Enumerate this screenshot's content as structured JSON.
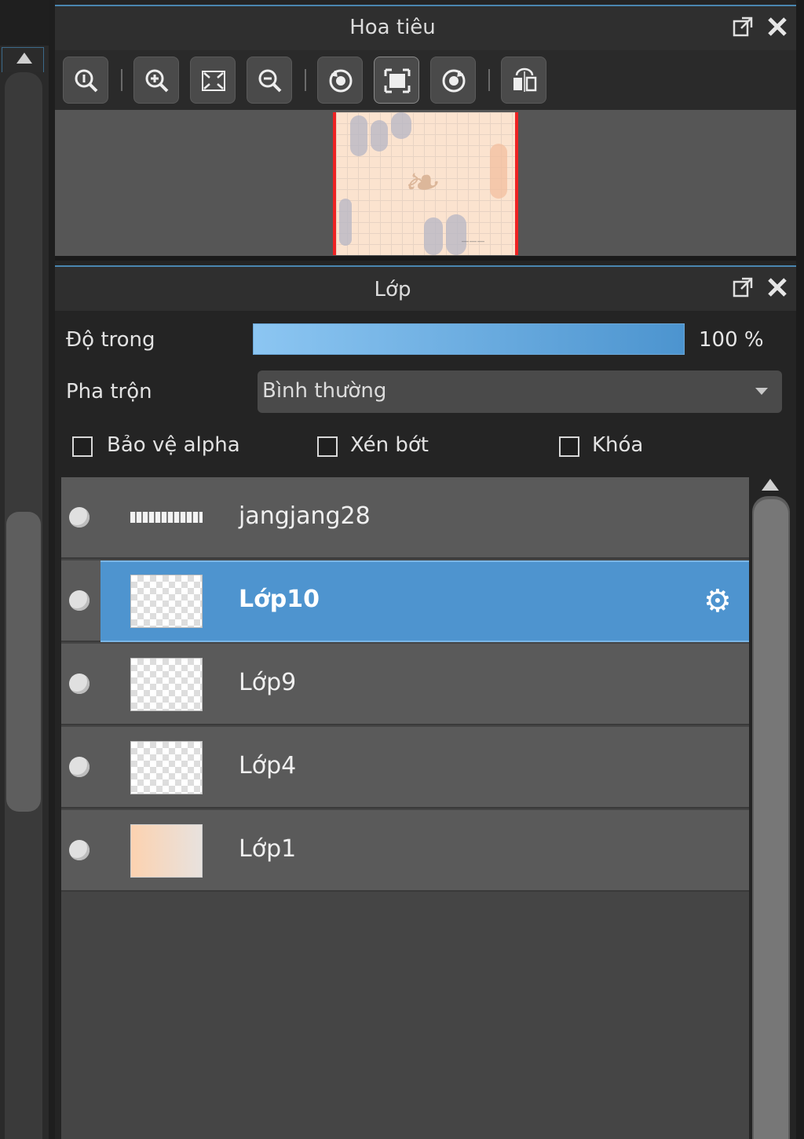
{
  "navigator": {
    "title": "Hoa tiêu",
    "toolbar": [
      {
        "name": "zoom-actual-icon"
      },
      {
        "name": "zoom-in-icon"
      },
      {
        "name": "fit-screen-icon"
      },
      {
        "name": "zoom-out-icon"
      },
      {
        "name": "rotate-left-icon"
      },
      {
        "name": "fit-canvas-icon"
      },
      {
        "name": "rotate-right-icon"
      },
      {
        "name": "flip-horizontal-icon"
      }
    ]
  },
  "layers_panel": {
    "title": "Lớp",
    "opacity_label": "Độ trong",
    "opacity_value": "100 %",
    "blend_label": "Pha trộn",
    "blend_value": "Bình thường",
    "checkboxes": {
      "protect_alpha": "Bảo vệ alpha",
      "clipping": "Xén bớt",
      "lock": "Khóa"
    },
    "layers": [
      {
        "name": "jangjang28",
        "selected": false
      },
      {
        "name": "Lớp10",
        "selected": true
      },
      {
        "name": "Lớp9",
        "selected": false
      },
      {
        "name": "Lớp4",
        "selected": false
      },
      {
        "name": "Lớp1",
        "selected": false
      }
    ]
  },
  "colors": {
    "accent": "#4e94cf",
    "panel_bg": "#242424",
    "row_bg": "#5a5a5a"
  }
}
